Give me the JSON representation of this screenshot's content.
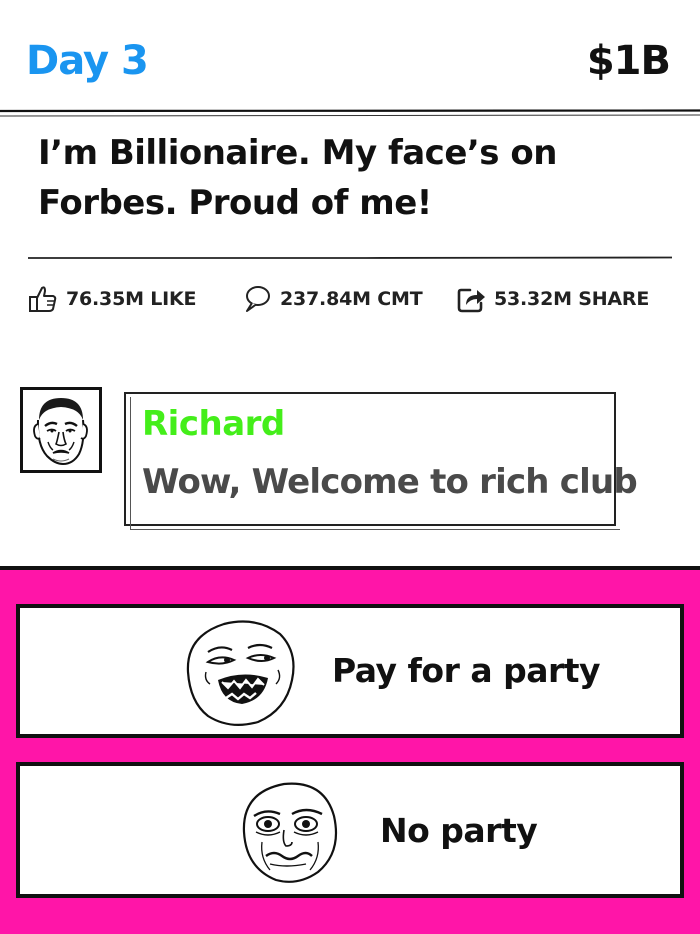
{
  "header": {
    "day_label": "Day 3",
    "money": "$1B",
    "day_color": "#1a95f0"
  },
  "post": {
    "text": "I’m Billionaire. My face’s on Forbes. Proud of me!"
  },
  "stats": {
    "likes": "76.35M LIKE",
    "likes_icon": "thumbs-up-icon",
    "comments": "237.84M CMT",
    "comments_icon": "speech-bubble-icon",
    "shares": "53.32M SHARE",
    "shares_icon": "share-arrow-icon"
  },
  "comment": {
    "name": "Richard",
    "text": "Wow, Welcome to rich club",
    "name_color": "#44ee1a",
    "avatar_icon": "rage-face-avatar"
  },
  "choices": {
    "panel_color": "#ff15a8",
    "items": [
      {
        "label": "Pay for a party",
        "icon": "sweet-jesus-face-icon"
      },
      {
        "label": "No party",
        "icon": "me-gusta-face-icon"
      }
    ]
  }
}
